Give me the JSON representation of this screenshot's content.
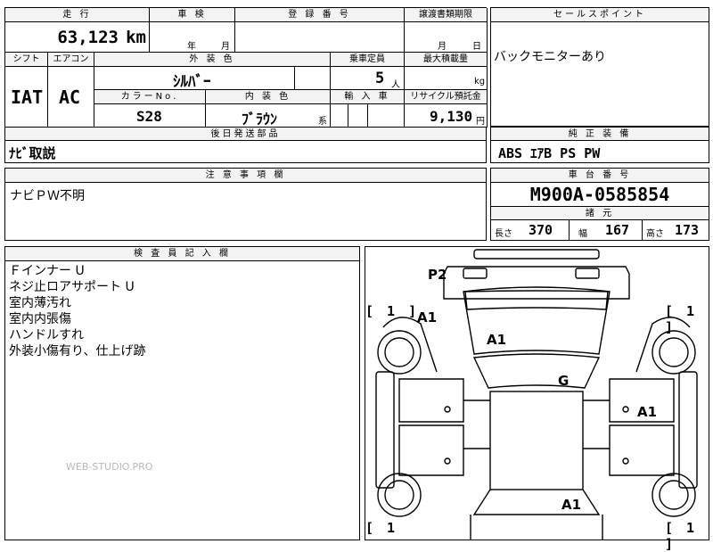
{
  "headers": {
    "mileage": "走 行",
    "inspection": "車 検",
    "registration_no": "登 録 番 号",
    "transfer_deadline": "譲渡書類期限",
    "sales_point": "セールスポイント",
    "shift": "シフト",
    "aircon": "エアコン",
    "exterior_color": "外 装 色",
    "capacity": "乗車定員",
    "max_load": "最大積載量",
    "color_no": "カラーNo.",
    "interior_color": "内 装 色",
    "import_car": "輸 入 車",
    "recycle_deposit": "リサイクル預託金",
    "later_parts": "後日発送部品",
    "standard_equipment": "純 正 装 備",
    "caution": "注 意 事 項 欄",
    "chassis_no": "車 台 番 号",
    "specs": "諸 元",
    "inspector": "検 査 員 記 入 欄"
  },
  "vehicle": {
    "mileage": "63,123",
    "mileage_unit": "km",
    "inspection_year_unit": "年",
    "inspection_month_unit": "月",
    "deadline_month_unit": "月",
    "deadline_day_unit": "日",
    "shift": "IAT",
    "aircon": "AC",
    "exterior_color": "ｼﾙﾊﾞｰ",
    "capacity": "5",
    "capacity_unit": "人",
    "max_load_unit": "kg",
    "color_no": "S28",
    "interior_color": "ﾌﾞﾗｳﾝ",
    "interior_suffix": "系",
    "recycle_deposit": "9,130",
    "recycle_unit": "円",
    "sales_point": "バックモニターあり",
    "later_parts": "ﾅﾋﾞ取説",
    "standard_equipment": "ABS ｴｱB PS PW",
    "caution": "ナビＰＷ不明",
    "chassis_no": "M900A-0585854",
    "length_label": "長さ",
    "length": "370",
    "width_label": "幅",
    "width": "167",
    "height_label": "高さ",
    "height": "173"
  },
  "inspector_notes": [
    "Ｆインナー U",
    "ネジ止ロアサポート U",
    "室内薄汚れ",
    "室内内張傷",
    "ハンドルすれ",
    "外装小傷有り、仕上げ跡"
  ],
  "watermark": "WEB-STUDIO.PRO",
  "diagram": {
    "marks": {
      "p2": "P2",
      "a1_front_left": "A1",
      "a1_hood": "A1",
      "g_windshield": "G",
      "a1_right_side": "A1",
      "a1_rear": "A1"
    },
    "brackets": {
      "front_left": "[ 1 ]",
      "front_right": "[ 1 ]",
      "rear_left": "[ 1",
      "rear_right": "[ 1 ]"
    }
  }
}
